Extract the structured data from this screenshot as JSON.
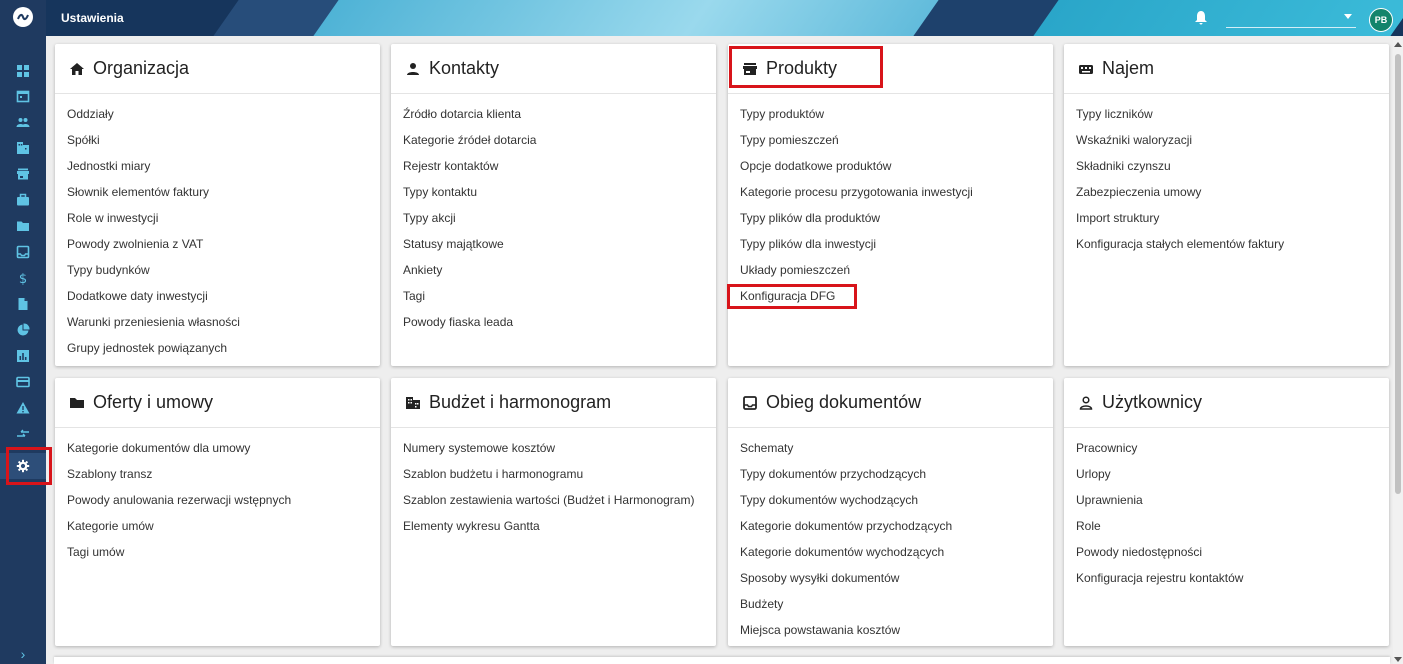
{
  "header": {
    "title": "Ustawienia",
    "user_initials": "PB"
  },
  "sidebar": {
    "items": [
      {
        "icon": "dashboard-icon"
      },
      {
        "icon": "calendar-icon"
      },
      {
        "icon": "people-icon"
      },
      {
        "icon": "building-icon"
      },
      {
        "icon": "store-icon"
      },
      {
        "icon": "briefcase-icon"
      },
      {
        "icon": "folder-icon"
      },
      {
        "icon": "inbox-icon"
      },
      {
        "icon": "dollar-icon"
      },
      {
        "icon": "document-icon"
      },
      {
        "icon": "pie-chart-icon"
      },
      {
        "icon": "bar-chart-icon"
      },
      {
        "icon": "card-icon"
      },
      {
        "icon": "warning-icon"
      },
      {
        "icon": "transfer-icon"
      },
      {
        "icon": "gear-icon"
      }
    ],
    "expand_label": "›"
  },
  "cards": {
    "organizacja": {
      "title": "Organizacja",
      "icon": "home-icon",
      "items": [
        "Oddziały",
        "Spółki",
        "Jednostki miary",
        "Słownik elementów faktury",
        "Role w inwestycji",
        "Powody zwolnienia z VAT",
        "Typy budynków",
        "Dodatkowe daty inwestycji",
        "Warunki przeniesienia własności",
        "Grupy jednostek powiązanych"
      ]
    },
    "kontakty": {
      "title": "Kontakty",
      "icon": "person-icon",
      "items": [
        "Źródło dotarcia klienta",
        "Kategorie źródeł dotarcia",
        "Rejestr kontaktów",
        "Typy kontaktu",
        "Typy akcji",
        "Statusy majątkowe",
        "Ankiety",
        "Tagi",
        "Powody fiaska leada"
      ]
    },
    "produkty": {
      "title": "Produkty",
      "icon": "store-icon",
      "items": [
        "Typy produktów",
        "Typy pomieszczeń",
        "Opcje dodatkowe produktów",
        "Kategorie procesu przygotowania inwestycji",
        "Typy plików dla produktów",
        "Typy plików dla inwestycji",
        "Układy pomieszczeń",
        "Konfiguracja DFG"
      ]
    },
    "najem": {
      "title": "Najem",
      "icon": "keyboard-icon",
      "items": [
        "Typy liczników",
        "Wskaźniki waloryzacji",
        "Składniki czynszu",
        "Zabezpieczenia umowy",
        "Import struktury",
        "Konfiguracja stałych elementów faktury"
      ]
    },
    "oferty": {
      "title": "Oferty i umowy",
      "icon": "folder-icon",
      "items": [
        "Kategorie dokumentów dla umowy",
        "Szablony transz",
        "Powody anulowania rezerwacji wstępnych",
        "Kategorie umów",
        "Tagi umów"
      ]
    },
    "budzet": {
      "title": "Budżet i harmonogram",
      "icon": "building-icon",
      "items": [
        "Numery systemowe kosztów",
        "Szablon budżetu i harmonogramu",
        "Szablon zestawienia wartości (Budżet i Harmonogram)",
        "Elementy wykresu Gantta"
      ]
    },
    "obieg": {
      "title": "Obieg dokumentów",
      "icon": "inbox-icon",
      "items": [
        "Schematy",
        "Typy dokumentów przychodzących",
        "Typy dokumentów wychodzących",
        "Kategorie dokumentów przychodzących",
        "Kategorie dokumentów wychodzących",
        "Sposoby wysyłki dokumentów",
        "Budżety",
        "Miejsca powstawania kosztów"
      ]
    },
    "uzytkownicy": {
      "title": "Użytkownicy",
      "icon": "person-outline-icon",
      "items": [
        "Pracownicy",
        "Urlopy",
        "Uprawnienia",
        "Role",
        "Powody niedostępności",
        "Konfiguracja rejestru kontaktów"
      ]
    }
  },
  "colors": {
    "sidebar": "#1f3a60",
    "header": "#16355c",
    "accent": "#5fc3e4",
    "highlight": "#d8141a"
  }
}
